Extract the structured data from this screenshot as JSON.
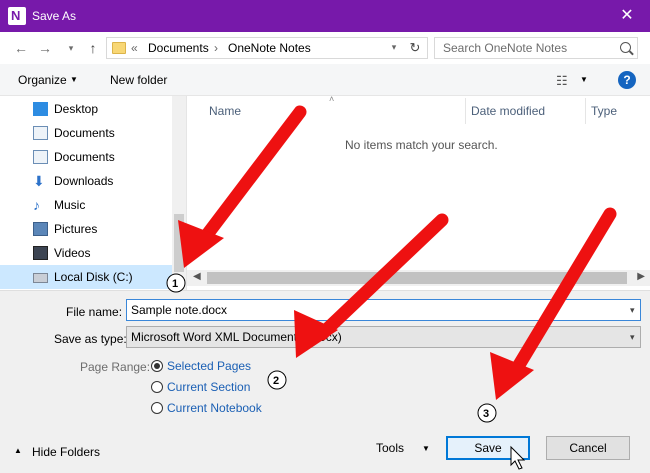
{
  "window": {
    "title": "Save As",
    "accent": "#7719aa"
  },
  "nav": {
    "back_icon": "back-arrow-icon",
    "forward_icon": "forward-arrow-icon",
    "up_icon": "up-arrow-icon"
  },
  "address": {
    "overflow": "«",
    "crumbs": [
      "Documents",
      "OneNote Notes"
    ],
    "separator": "›"
  },
  "search": {
    "placeholder": "Search OneNote Notes"
  },
  "toolbar": {
    "organize_label": "Organize",
    "new_folder_label": "New folder"
  },
  "sidebar": {
    "items": [
      {
        "label": "Desktop",
        "icon": "desktop-icon"
      },
      {
        "label": "Documents",
        "icon": "documents-icon"
      },
      {
        "label": "Documents",
        "icon": "documents-icon"
      },
      {
        "label": "Downloads",
        "icon": "downloads-icon"
      },
      {
        "label": "Music",
        "icon": "music-icon"
      },
      {
        "label": "Pictures",
        "icon": "pictures-icon"
      },
      {
        "label": "Videos",
        "icon": "videos-icon"
      },
      {
        "label": "Local Disk (C:)",
        "icon": "local-disk-icon",
        "selected": true
      }
    ]
  },
  "file_list": {
    "columns": [
      "Name",
      "Date modified",
      "Type"
    ],
    "empty_message": "No items match your search."
  },
  "form": {
    "filename_label": "File name:",
    "filename_value": "Sample note.docx",
    "savetype_label": "Save as type:",
    "savetype_value": "Microsoft Word XML Document (*.docx)",
    "page_range_label": "Page Range:",
    "page_range_options": [
      {
        "label": "Selected Pages",
        "checked": true
      },
      {
        "label": "Current Section",
        "checked": false
      },
      {
        "label": "Current Notebook",
        "checked": false
      }
    ]
  },
  "footer": {
    "hide_folders_label": "Hide Folders",
    "tools_label": "Tools",
    "save_label": "Save",
    "cancel_label": "Cancel"
  },
  "annotations": {
    "color": "#ee1111",
    "steps": [
      "1",
      "2",
      "3"
    ]
  }
}
